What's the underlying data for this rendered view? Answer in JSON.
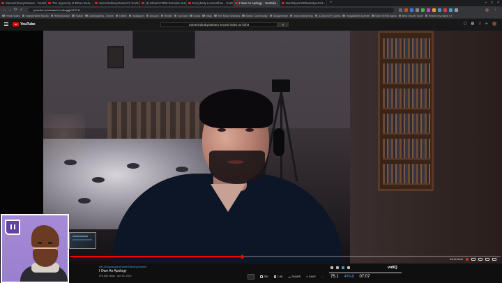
{
  "browser": {
    "tabs": [
      {
        "label": "SomeOrdinaryGamers - YouTube",
        "active": false
      },
      {
        "label": "The Hypocrisy of Ethan Klein",
        "active": false
      },
      {
        "label": "SomeOrdinaryGamers's YouTube",
        "active": false
      },
      {
        "label": "(1) Ethan's FIRM Donation to H3",
        "active": false
      },
      {
        "label": "Everybody Loses Ethan - YouTube",
        "active": false
      },
      {
        "label": "I Owe An Apology - YouTube",
        "active": true
      },
      {
        "label": "DarkSkyeXX3/DarkSkyeXX3",
        "active": false
      }
    ],
    "url": "youtube.com/watch?v=abqtgjnXF7LO",
    "bookmarks": [
      "Prime Video",
      "Independent Studio",
      "Reflectionism",
      "Twitch",
      "Dashingness - Home",
      "Twitter",
      "Instagram",
      "Discord",
      "Reddit",
      "YouTube",
      "Gmail",
      "eBay",
      "The Minor Warriors",
      "Steam Community",
      "Subgenesee",
      "music streaming",
      "[CustomXP] Opera",
      "megadeplet Aldenth",
      "SAN HERM Alpha",
      "Best Secret Toner",
      "Return my name n f"
    ]
  },
  "youtube": {
    "logo_text": "YouTube",
    "search_query": "SomeOrdinaryGamers second video on h3h3",
    "notification_count": "9+"
  },
  "video": {
    "hashtags": "#h3 #h3podcast #SomeOrdinaryGamers",
    "title": "I Owe An Apology",
    "views": "670,855 views · Apr 16, 2020",
    "likes": "78K",
    "dislikes": "1.5K",
    "share_label": "SHARE",
    "save_label": "SAVE",
    "progress_fraction": 0.4,
    "quality_label": "Screenshot"
  },
  "overlay": {
    "logo": "vidIQ",
    "stat_a": "75.1",
    "stat_b": "476.8",
    "stat_c": "07:07"
  },
  "colors": {
    "yt_red": "#ff0000",
    "twitch_purple": "#6441a5",
    "link_blue": "#3ea6ff"
  }
}
